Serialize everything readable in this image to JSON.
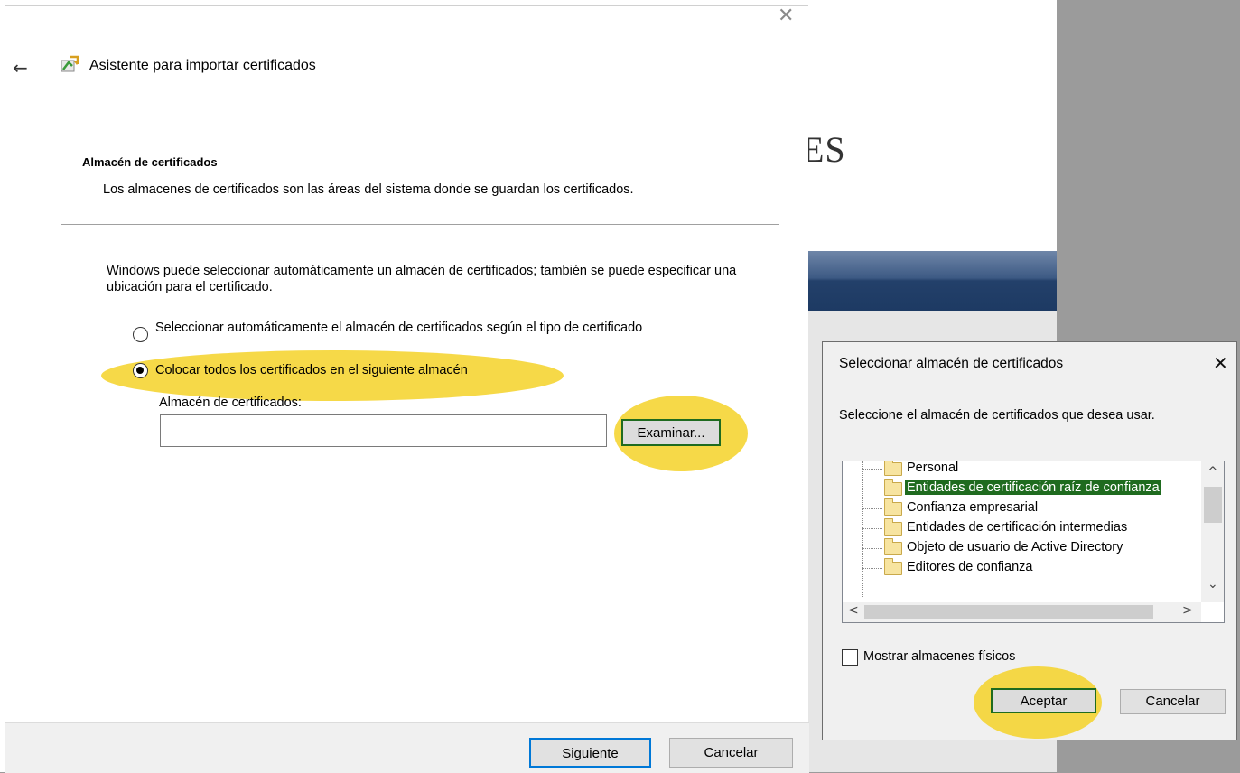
{
  "background": {
    "text_fragment": "ES"
  },
  "wizard": {
    "title": "Asistente para importar certificados",
    "section_title": "Almacén de certificados",
    "section_description": "Los almacenes de certificados son las áreas del sistema donde se guardan los certificados.",
    "body_text": "Windows puede seleccionar automáticamente un almacén de certificados; también se puede especificar una ubicación para el certificado.",
    "radio_auto_label": "Seleccionar automáticamente el almacén de certificados según el tipo de certificado",
    "radio_manual_label": "Colocar todos los certificados en el siguiente almacén",
    "store_label": "Almacén de certificados:",
    "store_value": "",
    "browse_button": "Examinar...",
    "next_button": "Siguiente",
    "cancel_button": "Cancelar",
    "icons": {
      "close": "close-icon",
      "back": "back-arrow-icon",
      "wizard": "certificate-import-icon"
    }
  },
  "dialog": {
    "title": "Seleccionar almacén de certificados",
    "prompt": "Seleccione el almacén de certificados que desea usar.",
    "stores": [
      "Personal",
      "Entidades de certificación raíz de confianza",
      "Confianza empresarial",
      "Entidades de certificación intermedias",
      "Objeto de usuario de Active Directory",
      "Editores de confianza"
    ],
    "selected_store": "Entidades de certificación raíz de confianza",
    "show_physical_label": "Mostrar almacenes físicos",
    "show_physical_checked": false,
    "ok_button": "Aceptar",
    "cancel_button": "Cancelar"
  },
  "colors": {
    "highlight": "#f5d228",
    "selection": "#1f6b1f",
    "focus_border": "#0078d7"
  }
}
